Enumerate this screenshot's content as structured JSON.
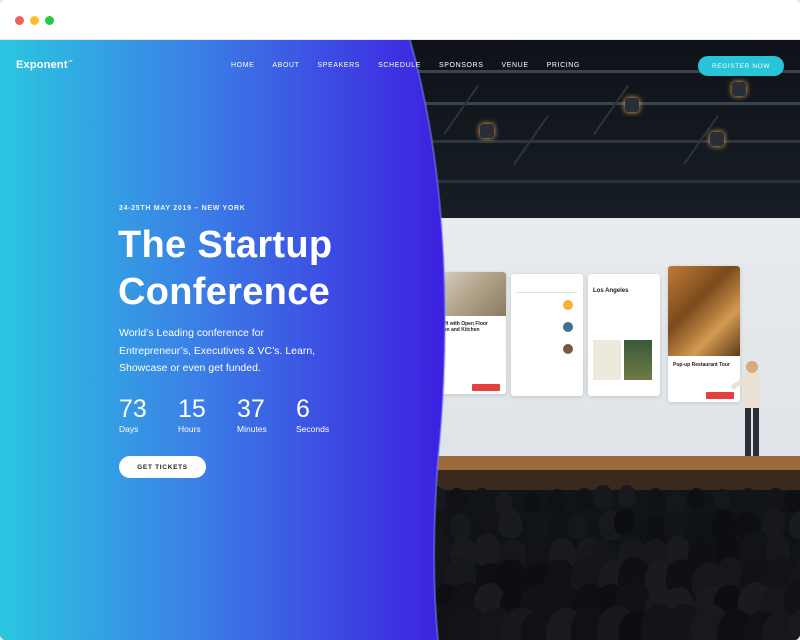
{
  "window": {
    "controls": [
      "close",
      "minimize",
      "maximize"
    ]
  },
  "brand": {
    "name": "Exponent",
    "mark": "™"
  },
  "nav": {
    "items": [
      "HOME",
      "ABOUT",
      "SPEAKERS",
      "SCHEDULE",
      "SPONSORS",
      "VENUE",
      "PRICING"
    ],
    "cta": "REGISTER NOW"
  },
  "hero": {
    "date": "24-25TH MAY 2019 – NEW YORK",
    "title_line1": "The Startup",
    "title_line2": "Conference",
    "description": "World’s Leading conference for Entrepreneur’s, Executives & VC’s. Learn, Showcase or even get funded.",
    "countdown": [
      {
        "value": "73",
        "label": "Days"
      },
      {
        "value": "15",
        "label": "Hours"
      },
      {
        "value": "37",
        "label": "Minutes"
      },
      {
        "value": "6",
        "label": "Seconds"
      }
    ],
    "cta": "GET TICKETS"
  },
  "slide": {
    "card1_title": "Loft with Open Floor Plan and Kitchen",
    "card3_title": "Los Angeles",
    "card4_title": "Pop-up Restaurant Tour"
  },
  "colors": {
    "gradient_start": "#2bc6e0",
    "gradient_end": "#3d1fe0",
    "accent": "#28c5d9"
  }
}
